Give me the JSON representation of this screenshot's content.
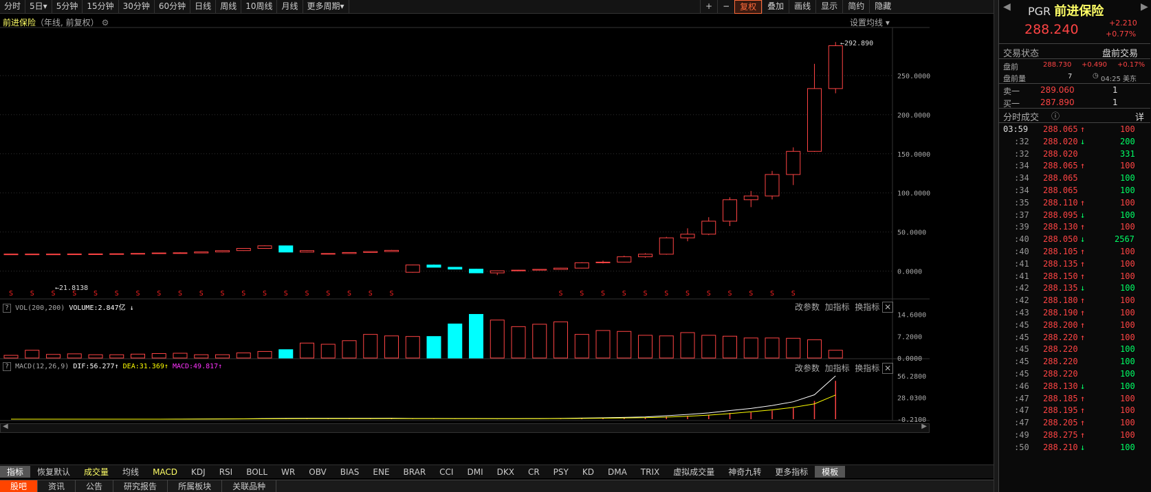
{
  "toolbar": {
    "periods": [
      "分时",
      "5日",
      "5分钟",
      "15分钟",
      "30分钟",
      "60分钟",
      "日线",
      "周线",
      "10周线",
      "月线",
      "更多周期"
    ],
    "right": [
      "+",
      "−",
      "复权",
      "叠加",
      "画线",
      "显示",
      "简约",
      "隐藏"
    ]
  },
  "chart": {
    "title": "前进保险",
    "subtitle": "（年线, 前复权）",
    "ma_setting": "设置均线",
    "max_label": "292.890",
    "min_label": "21.8138",
    "y_ticks": [
      "250.0000",
      "200.0000",
      "150.0000",
      "100.0000",
      "50.0000",
      "0.0000"
    ],
    "dividend_mark": "S"
  },
  "vol": {
    "label": "VOL(200,200)",
    "volume": "VOLUME:2.847亿",
    "arrow": "↓",
    "y_ticks": [
      "14.6000",
      "7.2000",
      "0.0000"
    ],
    "actions": [
      "改参数",
      "加指标",
      "换指标"
    ]
  },
  "macd": {
    "label": "MACD(12,26,9)",
    "dif": "DIF:56.277",
    "dea": "DEA:31.369",
    "macd": "MACD:49.817",
    "y_ticks": [
      "56.2800",
      "28.0300",
      "-0.2100"
    ],
    "actions": [
      "改参数",
      "加指标",
      "换指标"
    ]
  },
  "indicator_tabs": [
    "指标",
    "恢复默认",
    "成交量",
    "均线",
    "MACD",
    "KDJ",
    "RSI",
    "BOLL",
    "WR",
    "OBV",
    "BIAS",
    "ENE",
    "BRAR",
    "CCI",
    "DMI",
    "DKX",
    "CR",
    "PSY",
    "KD",
    "DMA",
    "TRIX",
    "虚拟成交量",
    "神奇九转",
    "更多指标",
    "模板"
  ],
  "bottom_tabs": [
    "股吧",
    "资讯",
    "公告",
    "研究报告",
    "所属板块",
    "关联品种"
  ],
  "quote": {
    "ticker": "PGR",
    "name": "前进保险",
    "price": "288.240",
    "change": "+2.210",
    "pct": "+0.77%",
    "status_label": "交易状态",
    "status": "盘前交易",
    "pre_label": "盘前",
    "pre_price": "288.730",
    "pre_change": "+0.490",
    "pre_pct": "+0.17%",
    "pre_vol_label": "盘前量",
    "pre_vol": "7",
    "time": "04:25 美东",
    "ask_label": "卖一",
    "ask": "289.060",
    "ask_vol": "1",
    "bid_label": "买一",
    "bid": "287.890",
    "bid_vol": "1",
    "ticks_label": "分时成交",
    "detail": "详"
  },
  "ticks": [
    [
      "03:59",
      "288.065",
      "↑",
      "100",
      "up"
    ],
    [
      ":32",
      "288.020",
      "↓",
      "200",
      "down"
    ],
    [
      ":32",
      "288.020",
      "",
      "331",
      "w"
    ],
    [
      ":34",
      "288.065",
      "↑",
      "100",
      "up"
    ],
    [
      ":34",
      "288.065",
      "",
      "100",
      "w"
    ],
    [
      ":34",
      "288.065",
      "",
      "100",
      "w"
    ],
    [
      ":35",
      "288.110",
      "↑",
      "100",
      "up"
    ],
    [
      ":37",
      "288.095",
      "↓",
      "100",
      "down"
    ],
    [
      ":39",
      "288.130",
      "↑",
      "100",
      "up"
    ],
    [
      ":40",
      "288.050",
      "↓",
      "2567",
      "down"
    ],
    [
      ":40",
      "288.105",
      "↑",
      "100",
      "up"
    ],
    [
      ":41",
      "288.135",
      "↑",
      "100",
      "up"
    ],
    [
      ":41",
      "288.150",
      "↑",
      "100",
      "up"
    ],
    [
      ":42",
      "288.135",
      "↓",
      "100",
      "down"
    ],
    [
      ":42",
      "288.180",
      "↑",
      "100",
      "up"
    ],
    [
      ":43",
      "288.190",
      "↑",
      "100",
      "up"
    ],
    [
      ":45",
      "288.200",
      "↑",
      "100",
      "up"
    ],
    [
      ":45",
      "288.220",
      "↑",
      "100",
      "up"
    ],
    [
      ":45",
      "288.220",
      "",
      "100",
      "w"
    ],
    [
      ":45",
      "288.220",
      "",
      "100",
      "w"
    ],
    [
      ":45",
      "288.220",
      "",
      "100",
      "w"
    ],
    [
      ":46",
      "288.130",
      "↓",
      "100",
      "down"
    ],
    [
      ":47",
      "288.185",
      "↑",
      "100",
      "up"
    ],
    [
      ":47",
      "288.195",
      "↑",
      "100",
      "up"
    ],
    [
      ":47",
      "288.205",
      "↑",
      "100",
      "up"
    ],
    [
      ":49",
      "288.275",
      "↑",
      "100",
      "up"
    ],
    [
      ":50",
      "288.210",
      "↓",
      "100",
      "down"
    ]
  ],
  "chart_data": {
    "type": "candlestick",
    "candles": [
      [
        21.8,
        21.8,
        21.8,
        21.8
      ],
      [
        21.8,
        21.8,
        21.8,
        21.8
      ],
      [
        21.8,
        21.8,
        21.8,
        21.8
      ],
      [
        21.9,
        22,
        21.7,
        21.9
      ],
      [
        22,
        22.1,
        21.8,
        22
      ],
      [
        22.1,
        22.3,
        21.9,
        22.2
      ],
      [
        22.2,
        22.8,
        22,
        22.6
      ],
      [
        22.6,
        23.4,
        22.4,
        23.2
      ],
      [
        23.2,
        24,
        22.9,
        23.4
      ],
      [
        23.2,
        24.8,
        23,
        24.5
      ],
      [
        24.5,
        26.5,
        24.1,
        26.2
      ],
      [
        26.2,
        29.4,
        25.8,
        29
      ],
      [
        29,
        32.8,
        28.6,
        32.3
      ],
      [
        32.3,
        24.5,
        32.6,
        24.3
      ],
      [
        24.3,
        26.6,
        23.8,
        26.2
      ],
      [
        22.1,
        22.7,
        21.9,
        22.5
      ],
      [
        22.5,
        24.1,
        22.3,
        23.8
      ],
      [
        23.8,
        25.2,
        23.5,
        25
      ],
      [
        25,
        27,
        24.8,
        26.5
      ],
      [
        -1.5,
        8.2,
        -2,
        7.8
      ],
      [
        7.8,
        5.2,
        8.5,
        4.9
      ],
      [
        4.9,
        2.7,
        5.3,
        2.5
      ],
      [
        2.5,
        -1.8,
        2.9,
        -2.3
      ],
      [
        -2.3,
        0.9,
        -5.1,
        0.4
      ],
      [
        0.4,
        1.5,
        -0.1,
        1.2
      ],
      [
        1.2,
        2.6,
        0.9,
        2.2
      ],
      [
        2.2,
        4.2,
        1.8,
        3.8
      ],
      [
        3.8,
        11.3,
        3.4,
        10.6
      ],
      [
        10.6,
        13.4,
        9.8,
        11.5
      ],
      [
        11.5,
        19.6,
        11,
        18.3
      ],
      [
        18.3,
        22.8,
        17.1,
        21.6
      ],
      [
        21.6,
        43.8,
        20.9,
        42.5
      ],
      [
        42.5,
        54.7,
        38.1,
        47.2
      ],
      [
        47.2,
        68.9,
        46,
        63.8
      ],
      [
        63.8,
        94.4,
        57.6,
        91.2
      ],
      [
        91.2,
        102.5,
        81.8,
        96.1
      ],
      [
        96.1,
        128.1,
        91.6,
        123.5
      ],
      [
        123.5,
        158.2,
        110,
        153.1
      ],
      [
        153.1,
        265.1,
        152.5,
        233.4
      ],
      [
        233.4,
        292.9,
        227.4,
        288.2
      ]
    ],
    "volume": [
      0.9,
      2.6,
      1.2,
      1.4,
      1.1,
      1.1,
      1.3,
      1.5,
      1.6,
      1.1,
      1.1,
      1.7,
      2.2,
      2.8,
      5,
      4.6,
      5.8,
      7.9,
      7.4,
      7.2,
      7.2,
      11.4,
      14.6,
      12.7,
      10.5,
      11.3,
      12.1,
      7.9,
      9.2,
      8.9,
      7.6,
      7.4,
      8.5,
      7.6,
      7.3,
      6.7,
      6.7,
      6.6,
      6.1,
      2.6
    ],
    "macd": [
      0,
      0,
      0,
      0,
      0,
      0,
      0,
      0,
      0.1,
      0.1,
      0.3,
      0.4,
      0.6,
      0.8,
      0.9,
      0.8,
      0.8,
      0.8,
      0.9,
      0.4,
      0.4,
      0.3,
      0.2,
      -0.1,
      0,
      0.2,
      0.4,
      0.9,
      1.1,
      1.4,
      1.7,
      3.5,
      4.2,
      5.6,
      8.1,
      8.9,
      11.2,
      14.6,
      23.7,
      49.8
    ],
    "dif": [
      0,
      0,
      0,
      0,
      0,
      0,
      0,
      0,
      0.1,
      0.2,
      0.3,
      0.5,
      0.8,
      1,
      1.1,
      1.1,
      1.1,
      1.1,
      1.2,
      0.9,
      0.9,
      0.8,
      0.8,
      0.7,
      0.7,
      0.8,
      1,
      1.4,
      1.8,
      2.3,
      2.9,
      4.5,
      6.1,
      8.1,
      11.2,
      14,
      17.7,
      22.6,
      31.7,
      56.3
    ],
    "dea": [
      0,
      0,
      0,
      0,
      0,
      0,
      0,
      0,
      0,
      0.1,
      0.2,
      0.3,
      0.5,
      0.6,
      0.7,
      0.7,
      0.7,
      0.7,
      0.8,
      0.7,
      0.7,
      0.7,
      0.7,
      0.7,
      0.7,
      0.7,
      0.8,
      1,
      1.2,
      1.6,
      2,
      2.7,
      3.8,
      5.3,
      7.2,
      9.6,
      12.1,
      15.3,
      19.9,
      31.4
    ]
  }
}
